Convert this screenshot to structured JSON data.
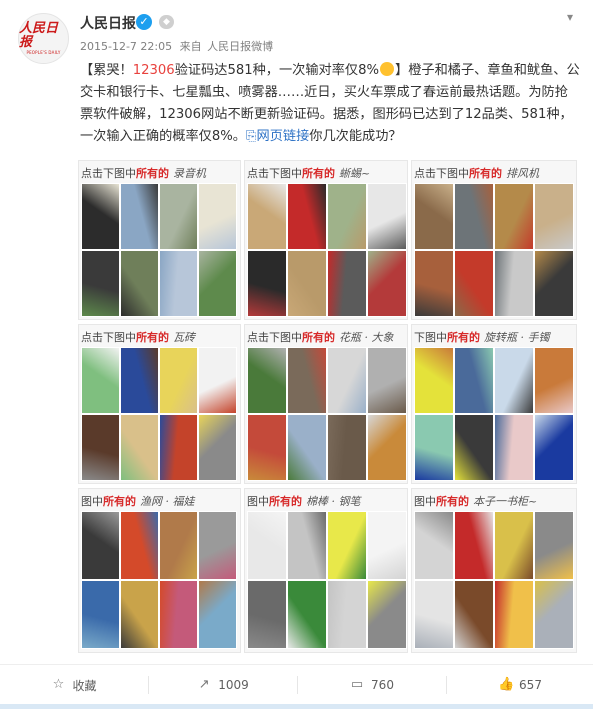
{
  "account": {
    "avatar_logo": "人民日报",
    "avatar_sub": "PEOPLE'S DAILY",
    "name": "人民日报",
    "verified_icon": "verified-badge-icon",
    "medal_icon": "medal-icon",
    "menu_icon": "chevron-down-icon"
  },
  "meta": {
    "timestamp": "2015-12-7 22:05",
    "source_prefix": "来自",
    "source": "人民日报微博"
  },
  "post": {
    "p1": "【累哭！",
    "p2": "12306",
    "p3": "验证码达581种，一次输对率仅8%",
    "p4": "】橙子和橘子、章鱼和鱿鱼、公交卡和银行卡、七星瓢虫、喷雾器……近日，买火车票成了春运前最热话题。为防抢票软件破解，12306网站不断更新验证码。据悉，图形码已达到了12品类、581种，一次输入正确的概率仅8%。",
    "link_icon": "link-icon",
    "link_text": "网页链接",
    "p5": "你几次能成功？"
  },
  "captchas": {
    "prompt_full": "点击下图中",
    "prompt_partial_1": "点击下图中",
    "prompt_partial_2": "图中",
    "prompt_partial_3": "击下图中",
    "prompt_partial_4": "下图中",
    "emphasis": "所有的",
    "items": [
      {
        "hand": "录音机"
      },
      {
        "hand": "蜥蜴~"
      },
      {
        "hand": "排风机"
      },
      {
        "hand": "瓦砖"
      },
      {
        "hand": "花瓶 · 大象"
      },
      {
        "hand": "旋转瓶 · 手镯"
      },
      {
        "hand": "渔网 · 福娃"
      },
      {
        "hand": "棉棒 · 钢笔"
      },
      {
        "hand": "本子一书柜~"
      }
    ],
    "colors": {
      "accent": "#d72a2a"
    }
  },
  "actions": [
    {
      "icon": "star-icon",
      "label": "收藏"
    },
    {
      "icon": "repost-icon",
      "label": "1009"
    },
    {
      "icon": "comment-icon",
      "label": "760"
    },
    {
      "icon": "thumbs-up-icon",
      "label": "657"
    }
  ],
  "colors": {
    "link": "#2f73c6",
    "highlight": "#e8423e",
    "verified": "#1d9fef"
  }
}
